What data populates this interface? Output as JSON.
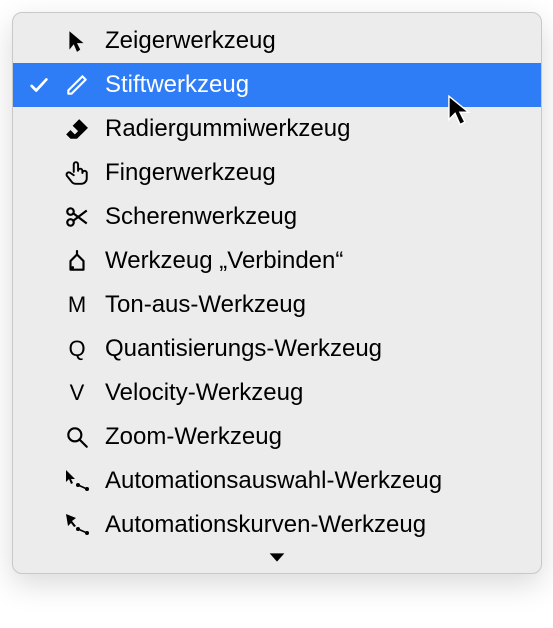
{
  "menu": {
    "items": [
      {
        "id": "pointer",
        "label": "Zeigerwerkzeug",
        "icon": "cursor-icon",
        "selected": false
      },
      {
        "id": "pencil",
        "label": "Stiftwerkzeug",
        "icon": "pencil-icon",
        "selected": true
      },
      {
        "id": "eraser",
        "label": "Radiergummiwerkzeug",
        "icon": "eraser-icon",
        "selected": false
      },
      {
        "id": "finger",
        "label": "Fingerwerkzeug",
        "icon": "finger-icon",
        "selected": false
      },
      {
        "id": "scissors",
        "label": "Scherenwerkzeug",
        "icon": "scissors-icon",
        "selected": false
      },
      {
        "id": "glue",
        "label": "Werkzeug „Verbinden“",
        "icon": "glue-icon",
        "selected": false
      },
      {
        "id": "mute",
        "label": "Ton-aus-Werkzeug",
        "icon": "letter-M-icon",
        "letter": "M",
        "selected": false
      },
      {
        "id": "quantize",
        "label": "Quantisierungs-Werkzeug",
        "icon": "letter-Q-icon",
        "letter": "Q",
        "selected": false
      },
      {
        "id": "velocity",
        "label": "Velocity-Werkzeug",
        "icon": "letter-V-icon",
        "letter": "V",
        "selected": false
      },
      {
        "id": "zoom",
        "label": "Zoom-Werkzeug",
        "icon": "magnifier-icon",
        "selected": false
      },
      {
        "id": "automation-select",
        "label": "Automationsauswahl-Werkzeug",
        "icon": "automation-select-icon",
        "selected": false
      },
      {
        "id": "automation-curve",
        "label": "Automationskurven-Werkzeug",
        "icon": "automation-curve-icon",
        "selected": false
      }
    ]
  },
  "colors": {
    "selection": "#2e7cf6",
    "background": "#ececec",
    "text": "#000000",
    "textSelected": "#ffffff"
  }
}
